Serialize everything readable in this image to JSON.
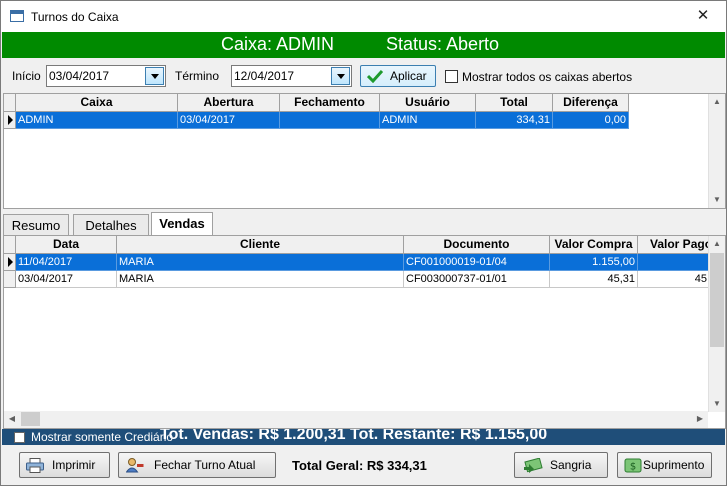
{
  "window": {
    "title": "Turnos do Caixa",
    "close_glyph": "✕"
  },
  "header": {
    "caixa_text": "Caixa: ADMIN",
    "status_text": "Status: Aberto",
    "bg_color": "#008a00"
  },
  "filters": {
    "inicio_label": "Início",
    "inicio_value": "03/04/2017",
    "termino_label": "Término",
    "termino_value": "12/04/2017",
    "apply_label": "Aplicar",
    "show_all_label": "Mostrar todos os caixas abertos"
  },
  "turnos_grid": {
    "columns": [
      "Caixa",
      "Abertura",
      "Fechamento",
      "Usuário",
      "Total",
      "Diferença"
    ],
    "rows": [
      [
        "ADMIN",
        "03/04/2017",
        "",
        "ADMIN",
        "334,31",
        "0,00"
      ]
    ]
  },
  "tabs": [
    "Resumo",
    "Detalhes",
    "Vendas"
  ],
  "active_tab": "Vendas",
  "vendas_grid": {
    "columns": [
      "Data",
      "Cliente",
      "Documento",
      "Valor Compra",
      "Valor Pago"
    ],
    "rows": [
      [
        "11/04/2017",
        "MARIA",
        "CF001000019-01/04",
        "1.155,00",
        ""
      ],
      [
        "03/04/2017",
        "MARIA",
        "CF003000737-01/01",
        "45,31",
        "45"
      ]
    ]
  },
  "totals": {
    "show_credit_label": "Mostrar somente Crediário",
    "summary_text": "Tot. Vendas: R$ 1.200,31  Tot. Restante: R$ 1.155,00"
  },
  "footer": {
    "print_label": "Imprimir",
    "close_shift_label": "Fechar Turno Atual",
    "total_geral": "Total Geral: R$ 334,31",
    "sangria_label": "Sangria",
    "suprimento_label": "Suprimento"
  }
}
